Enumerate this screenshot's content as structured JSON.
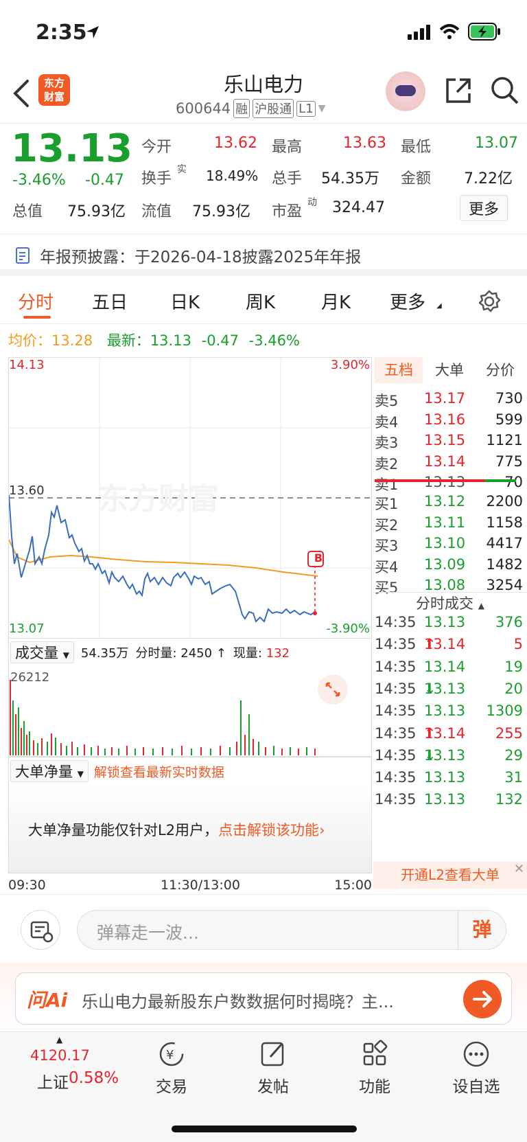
{
  "status": {
    "time": "2:35"
  },
  "header": {
    "title": "乐山电力",
    "code": "600644",
    "tag_rong": "融",
    "tag_hgt": "沪股通",
    "tag_l1": "L1",
    "logo_line1": "东方",
    "logo_line2": "财富"
  },
  "quote": {
    "price": "13.13",
    "pct": "-3.46%",
    "chg": "-0.47",
    "open_label": "今开",
    "open": "13.62",
    "high_label": "最高",
    "high": "13.63",
    "low_label": "最低",
    "low": "13.07",
    "turnover_label": "换手",
    "turnover_sup": "实",
    "turnover": "18.49%",
    "vol_label": "总手",
    "vol": "54.35万",
    "amount_label": "金额",
    "amount": "7.22亿",
    "mcap_label": "总值",
    "mcap": "75.93亿",
    "float_label": "流值",
    "float": "75.93亿",
    "pe_label": "市盈",
    "pe_sup": "动",
    "pe": "324.47",
    "more": "更多"
  },
  "notice": {
    "text": "年报预披露：于2026-04-18披露2025年年报"
  },
  "tabs": [
    "分时",
    "五日",
    "日K",
    "周K",
    "月K",
    "更多"
  ],
  "avgline": {
    "avg_label": "均价：",
    "avg": "13.28",
    "latest_label": "最新：",
    "latest": "13.13",
    "chg": "-0.47",
    "pct": "-3.46%"
  },
  "chart": {
    "ymax": "14.13",
    "ymaxpct": "3.90%",
    "ymid": "13.60",
    "ymin": "13.07",
    "yminpct": "-3.90%",
    "watermark": "东方财富",
    "marker": "B"
  },
  "volume": {
    "selector": "成交量",
    "total": "54.35万",
    "fs_label": "分时量:",
    "fs": "2450",
    "arrow": "↑",
    "now_label": "现量:",
    "now": "132",
    "max": "26212"
  },
  "ddj": {
    "selector": "大单净量",
    "unlock_hint": "解锁查看最新实时数据",
    "msg": "大单净量功能仅针对L2用户，",
    "link": "点击解锁该功能"
  },
  "timeaxis": {
    "start": "09:30",
    "mid": "11:30/13:00",
    "end": "15:00"
  },
  "book": {
    "tabs": [
      "五档",
      "大单",
      "分价"
    ],
    "asks": [
      {
        "l": "卖5",
        "p": "13.17",
        "v": "730"
      },
      {
        "l": "卖4",
        "p": "13.16",
        "v": "599"
      },
      {
        "l": "卖3",
        "p": "13.15",
        "v": "1121"
      },
      {
        "l": "卖2",
        "p": "13.14",
        "v": "775"
      },
      {
        "l": "卖1",
        "p": "13.13",
        "v": "70"
      }
    ],
    "bids": [
      {
        "l": "买1",
        "p": "13.12",
        "v": "2200"
      },
      {
        "l": "买2",
        "p": "13.11",
        "v": "1158"
      },
      {
        "l": "买3",
        "p": "13.10",
        "v": "4417"
      },
      {
        "l": "买4",
        "p": "13.09",
        "v": "1482"
      },
      {
        "l": "买5",
        "p": "13.08",
        "v": "3254"
      }
    ],
    "ticks_title": "分时成交",
    "ticks": [
      {
        "t": "14:35",
        "p": "13.13",
        "a": "",
        "v": "376"
      },
      {
        "t": "14:35",
        "p": "13.14",
        "a": "↑",
        "v": "5"
      },
      {
        "t": "14:35",
        "p": "13.14",
        "a": "",
        "v": "19"
      },
      {
        "t": "14:35",
        "p": "13.13",
        "a": "↓",
        "v": "20"
      },
      {
        "t": "14:35",
        "p": "13.13",
        "a": "",
        "v": "1309"
      },
      {
        "t": "14:35",
        "p": "13.14",
        "a": "↑",
        "v": "255"
      },
      {
        "t": "14:35",
        "p": "13.13",
        "a": "↓",
        "v": "29"
      },
      {
        "t": "14:35",
        "p": "13.13",
        "a": "",
        "v": "31"
      },
      {
        "t": "14:35",
        "p": "13.13",
        "a": "",
        "v": "132"
      }
    ],
    "l2": "开通L2查看大单"
  },
  "danmu": {
    "placeholder": "弹幕走一波...",
    "btn": "弹"
  },
  "ai": {
    "logo": "问Ai",
    "text": "乐山电力最新股东户数数据何时揭晓？主..."
  },
  "nav": {
    "index_value": "4120.17",
    "index_name": "上证",
    "index_pct": "0.58%",
    "items": [
      "交易",
      "发帖",
      "功能",
      "设自选"
    ]
  }
}
